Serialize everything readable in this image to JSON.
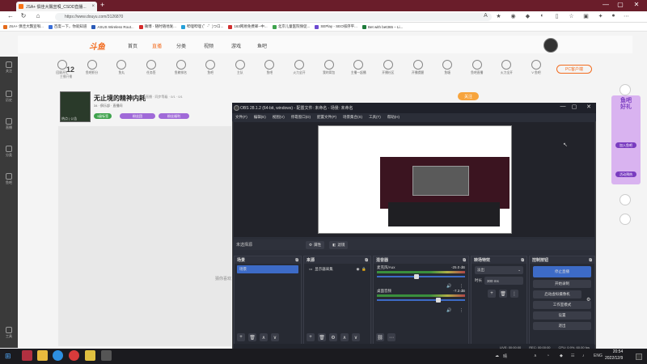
{
  "browser": {
    "tab_title": "JSA+ 俱佳大飄宣唄_CSDD直播...",
    "tab_close": "×",
    "new_tab": "+",
    "window_controls": [
      "—",
      "▢",
      "✕"
    ],
    "url": "https://www.douyu.com/3126870",
    "bookmarks": [
      "JSA+ 俱佳大飄宣唄...",
      "百度一下，你就知道",
      "ASUS Wireless Rout...",
      "微博 - 随时随地发...",
      "哔哩哔哩 (゜-゜)つロ...",
      "163网易免费邮--中...",
      "北京儿童医院保促...",
      "SEPlay - SEO排序平...",
      "Bet with bet365 – Li..."
    ]
  },
  "douyu": {
    "logo": "斗鱼",
    "nav": [
      "首页",
      "直播",
      "分类",
      "视频",
      "游戏",
      "鱼吧"
    ],
    "nav_active_index": 1,
    "follow_count": "12",
    "follow_label": "主播开播",
    "categories": [
      "回顾开忙",
      "鱼吧积分",
      "鱼丸",
      "任务签",
      "鱼粮排名",
      "鱼吧",
      "主队",
      "鱼吧",
      "火力全开",
      "我的背包",
      "主播一起播",
      "开播社区",
      "开播提醒",
      "鱼塘",
      "鱼吧直播",
      "火力全开",
      "V 鱼吧",
      "鱼吧",
      "鱼吧",
      "主播小助",
      "鱼吧",
      "主播"
    ],
    "pc_button": "PC客户端",
    "left_rail": [
      "关注",
      "历史",
      "直播",
      "分类",
      "鱼吧",
      "工具"
    ],
    "stream_title": "无止境的精神内耗",
    "stream_sub": "直播 · 同步等级 · 0/1 · 0/1",
    "stream_room": "34 · 俱乐部 · 直播间",
    "thumb_label": "热点 | 公告",
    "pills": [
      "1级标签",
      "粉丝团",
      "粉丝福利"
    ],
    "hdr_button": "关注",
    "side_tag": "猜你喜欢",
    "right_ad": "鱼吧\n好礼",
    "right_ad_buttons": [
      "加入鱼吧",
      "活动预热"
    ]
  },
  "obs": {
    "title": "OBS 28.1.2 (64-bit, windows) - 配置文件: 未命名 - 场景: 未命名",
    "window_controls": [
      "—",
      "▢",
      "✕"
    ],
    "menu": [
      "文件(F)",
      "编辑(E)",
      "视图(V)",
      "停靠窗口(D)",
      "配置文件(P)",
      "场景集合(S)",
      "工具(T)",
      "帮助(H)"
    ],
    "no_source": "未选择源",
    "props_button": "属性",
    "filters_button": "滤镜",
    "scenes": {
      "title": "场景",
      "items": [
        "场景"
      ]
    },
    "sources": {
      "title": "来源",
      "items": [
        "显示器采集"
      ]
    },
    "mixer": {
      "title": "混音器",
      "tracks": [
        {
          "name": "麦克风/Aux",
          "db": "-25.0 dB",
          "level": 0.45
        },
        {
          "name": "桌面音频",
          "db": "-7.3 dB",
          "level": 0.7
        }
      ]
    },
    "transitions": {
      "title": "转场特效",
      "type": "淡出",
      "duration_label": "时长",
      "duration": "300 ms"
    },
    "controls": {
      "title": "控制按钮",
      "buttons": [
        "停止直播",
        "开始录制",
        "启动虚拟摄像机",
        "工作室模式",
        "设置",
        "退出"
      ]
    },
    "status": [
      "LIVE: 00:00:00",
      "REC: 00:00:00",
      "CPU: 0.9%, 60.00 fps"
    ]
  },
  "taskbar": {
    "time": "20:54",
    "date": "2022/12/9",
    "lang": "ENG",
    "weather": "晴"
  },
  "colors": {
    "douyu_orange": "#f26d21",
    "obs_blue": "#3d6bc7",
    "browser_titlebar": "#6a1d2a"
  }
}
